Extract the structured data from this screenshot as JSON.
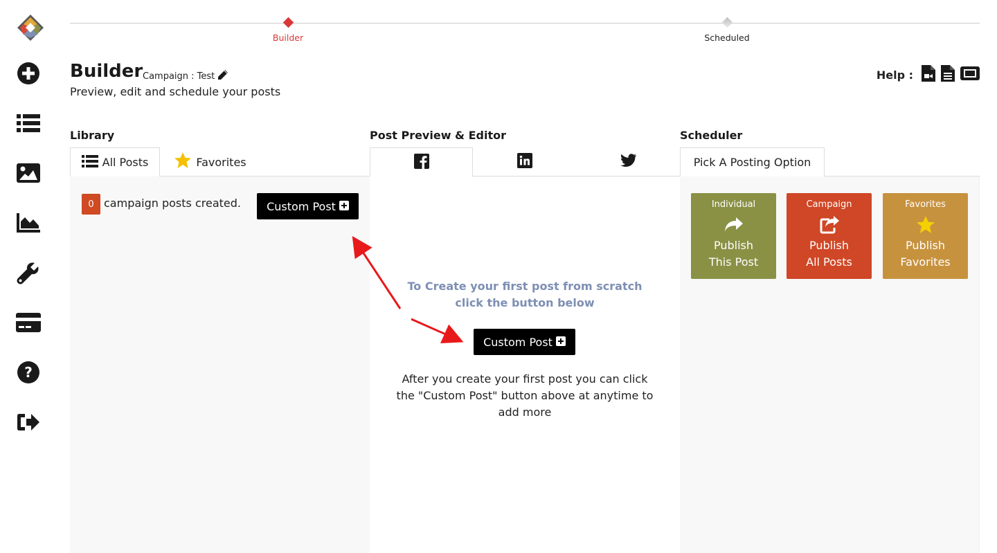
{
  "colors": {
    "accent": "#d9383a",
    "dark": "#1a1a1a",
    "individual": "#8a9145",
    "campaign": "#cf4726",
    "favorites": "#c7923e",
    "badge": "#d04a23",
    "hint": "#7d8fb3"
  },
  "sidebar": {
    "icons": [
      "logo-icon",
      "plus-circle-icon",
      "list-icon",
      "image-icon",
      "chart-area-icon",
      "wrench-icon",
      "credit-card-icon",
      "question-circle-icon",
      "sign-out-icon"
    ]
  },
  "stepper": {
    "steps": [
      {
        "label": "Builder",
        "active": true
      },
      {
        "label": "Scheduled",
        "active": false
      }
    ]
  },
  "header": {
    "title": "Builder",
    "campaign": "Campaign : Test",
    "subtitle": "Preview, edit and schedule your posts",
    "help_label": "Help :"
  },
  "library": {
    "title": "Library",
    "tabs": [
      {
        "label": "All Posts",
        "icon": "list-icon",
        "active": true
      },
      {
        "label": "Favorites",
        "icon": "star-icon",
        "active": false
      }
    ],
    "count": "0",
    "count_text": "campaign posts created.",
    "custom_post_label": "Custom Post"
  },
  "editor": {
    "title": "Post Preview & Editor",
    "tabs": [
      {
        "icon": "facebook-icon",
        "active": true
      },
      {
        "icon": "linkedin-icon",
        "active": false
      },
      {
        "icon": "twitter-icon",
        "active": false
      }
    ],
    "hint_line1": "To Create your first post from scratch",
    "hint_line2": "click the button below",
    "custom_post_label": "Custom Post",
    "after_text": "After you create your first post you can click the \"Custom Post\" button above at anytime to add more"
  },
  "scheduler": {
    "title": "Scheduler",
    "tab_label": "Pick A Posting Option",
    "options": [
      {
        "head": "Individual",
        "line1": "Publish",
        "line2": "This Post",
        "icon": "share-icon"
      },
      {
        "head": "Campaign",
        "line1": "Publish",
        "line2": "All Posts",
        "icon": "share-square-icon"
      },
      {
        "head": "Favorites",
        "line1": "Publish",
        "line2": "Favorites",
        "icon": "star-icon"
      }
    ]
  }
}
